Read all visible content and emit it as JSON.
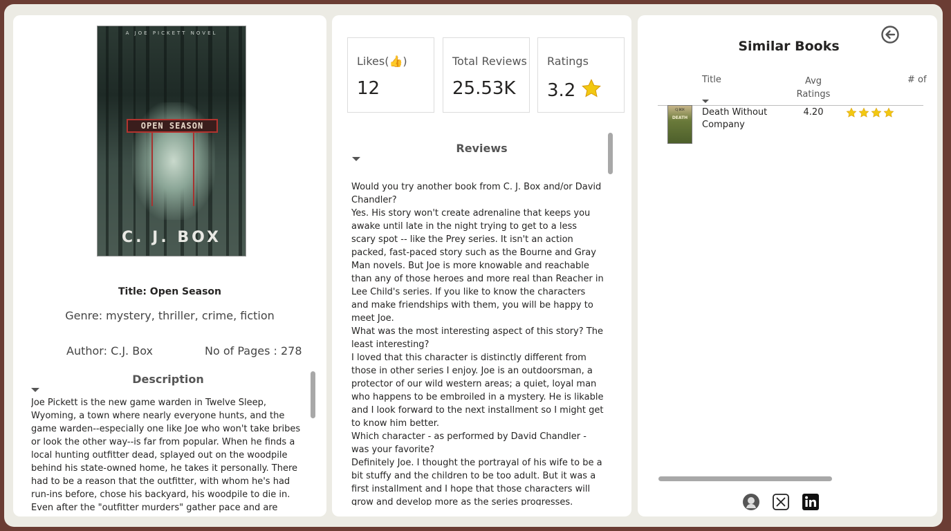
{
  "book": {
    "cover": {
      "series_text": "A JOE PICKETT NOVEL",
      "title_text": "OPEN SEASON",
      "author_text": "C. J. BOX"
    },
    "title_label": "Title:",
    "title": "Open Season",
    "genre": "Genre: mystery, thriller, crime, fiction",
    "author": "Author: C.J. Box",
    "pages": "No of Pages : 278",
    "description_heading": "Description",
    "description": "Joe Pickett is the new game warden in Twelve Sleep, Wyoming, a town where nearly everyone hunts, and the game warden--especially one like Joe who won't take bribes or look the other way--is far from popular. When he finds a local hunting outfitter dead, splayed out on the woodpile behind his state-owned home, he takes it personally. There had to be a reason that the outfitter, with whom he's had run-ins before, chose his backyard, his woodpile to die in. Even after the \"outfitter murders\" gather pace and are claimed by the local powers of the law..."
  },
  "stats": {
    "likes_label": "Likes(",
    "likes_icon": "👍",
    "likes_label_end": ")",
    "likes_value": "12",
    "reviews_label": "Total Reviews",
    "reviews_value": "25.53K",
    "ratings_label": "Ratings",
    "ratings_value": "3.2",
    "star_color": "#f2c811"
  },
  "reviews": {
    "heading": "Reviews",
    "text": "Would you try another book from C. J. Box and/or David Chandler?\nYes. His story won't create adrenaline that keeps you awake until late in the night trying to get to a less scary spot -- like the Prey series. It isn't an action packed, fast-paced story such as the Bourne and Gray Man novels. But Joe is more knowable and reachable than any of those heroes and more real than Reacher in Lee Child's series. If you like to know the characters and make friendships with them, you will be happy to meet Joe.\nWhat was the most interesting aspect of this story? The least interesting?\nI loved that this character is distinctly different from those in other series I enjoy. Joe is an outdoorsman, a protector of our wild western areas; a quiet, loyal man who happens to be embroiled in a mystery. He is likable and I look forward to the next installment so I might get to know him better.\nWhich character - as performed by David Chandler - was your favorite?\nDefinitely Joe. I thought the portrayal of his wife to be a bit stuffy and the children to be too adult. But it was a first installment and I hope that those characters will grow and develop more as the series progresses."
  },
  "similar": {
    "heading": "Similar Books",
    "columns": [
      "Title",
      "Avg Ratings",
      "# of"
    ],
    "rows": [
      {
        "title": "Death Without Company",
        "avg_rating": "4.20",
        "stars": 4,
        "thumb_top": "CJ BOX",
        "thumb_title": "DEATH"
      }
    ]
  },
  "social": {
    "icons": [
      "github-icon",
      "x-icon",
      "linkedin-icon"
    ]
  },
  "colors": {
    "background": "#6b3d34",
    "frame": "#ecebe4",
    "panel": "#ffffff"
  }
}
